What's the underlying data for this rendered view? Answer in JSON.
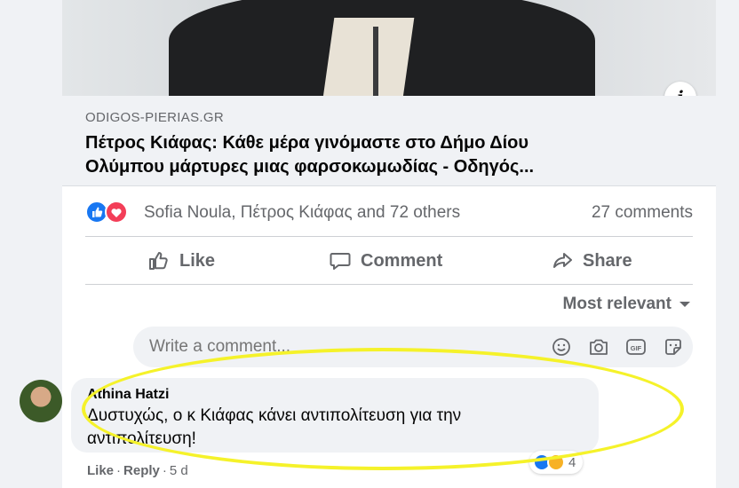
{
  "link": {
    "domain": "ODIGOS-PIERIAS.GR",
    "title_line1": "Πέτρος Κιάφας: Κάθε μέρα γινόμαστε στο Δήμο Δίου",
    "title_line2": "Ολύμπου μάρτυρες μιας φαρσοκωμωδίας - Οδηγός..."
  },
  "info_button": {
    "label": "i",
    "icon": "info-icon"
  },
  "reactions": {
    "names": "Sofia Noula, Πέτρος Κιάφας and 72 others",
    "comments": "27 comments",
    "icons": [
      "like-reaction-icon",
      "love-reaction-icon"
    ]
  },
  "actions": {
    "like": "Like",
    "comment": "Comment",
    "share": "Share"
  },
  "sort": {
    "label": "Most relevant"
  },
  "composer": {
    "placeholder": "Write a comment...",
    "icons": [
      "emoji-icon",
      "camera-icon",
      "gif-icon",
      "sticker-icon"
    ]
  },
  "comment": {
    "author": "Athina Hatzi",
    "text_line1": "Δυστυχώς, ο κ Κιάφας κάνει αντιπολίτευση για την",
    "text_line2": "αντιπολίτευση!",
    "reaction_count": "4",
    "like": "Like",
    "reply": "Reply",
    "time": "5 d"
  },
  "colors": {
    "accent": "#1877f2",
    "love": "#f33e58",
    "annotation": "#f5f22a",
    "muted_text": "#65676b"
  }
}
